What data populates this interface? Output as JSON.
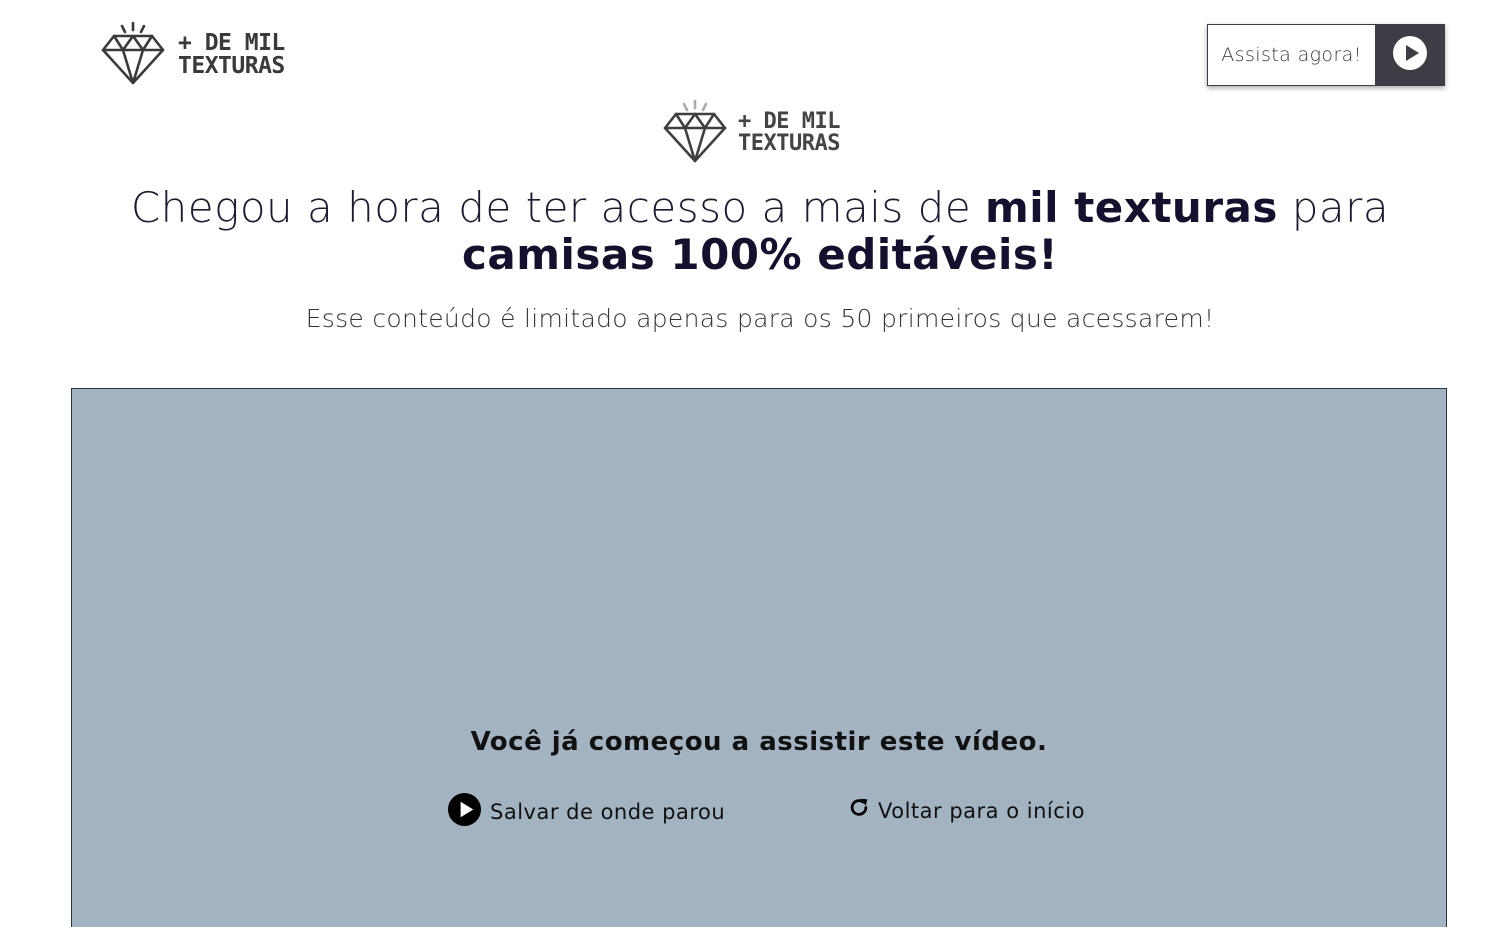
{
  "header": {
    "logo": {
      "line1": "+ DE MIL",
      "line2": "TEXTURAS",
      "icon": "diamond-icon"
    },
    "cta": {
      "label": "Assista agora!",
      "icon": "play-circle-icon"
    }
  },
  "hero": {
    "logo": {
      "line1": "+ DE MIL",
      "line2": "TEXTURAS",
      "icon": "diamond-icon"
    },
    "headline": {
      "part1": "Chegou a hora de ter acesso a mais de ",
      "bold1": "mil texturas",
      "part2": " para ",
      "bold2": "camisas 100% editáveis!"
    },
    "subline": "Esse conteúdo é limitado apenas para os 50 primeiros que acessarem!"
  },
  "video": {
    "background_color": "#a3b3c1",
    "resume_title": "Você já começou a assistir este vídeo.",
    "save_label": "Salvar de onde parou",
    "save_icon": "play-circle-icon",
    "restart_label": "Voltar para o início",
    "restart_icon": "redo-icon"
  },
  "colors": {
    "cta_dark": "#3d3e45",
    "headline": "#15102e"
  }
}
